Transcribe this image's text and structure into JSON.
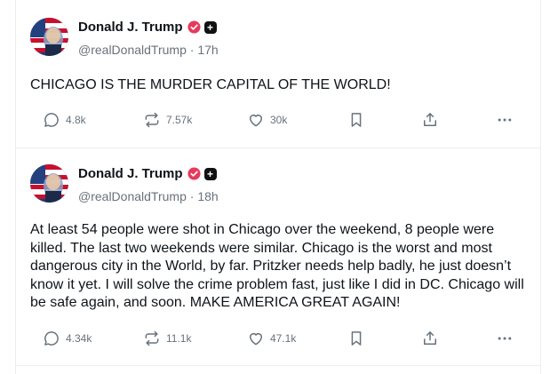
{
  "posts": [
    {
      "author": "Donald J. Trump",
      "handle": "@realDonaldTrump",
      "time": "17h",
      "text": "CHICAGO IS THE MURDER CAPITAL OF THE WORLD!",
      "replies": "4.8k",
      "reposts": "7.57k",
      "likes": "30k"
    },
    {
      "author": "Donald J. Trump",
      "handle": "@realDonaldTrump",
      "time": "18h",
      "text": "At least 54 people were shot in Chicago over the weekend, 8 people were killed. The last two weekends were similar. Chicago is the worst and most dangerous city in the World, by far. Pritzker needs help badly, he just doesn’t know it yet. I will solve the crime problem fast, just like I did in DC. Chicago will be safe again, and soon. MAKE AMERICA GREAT AGAIN!",
      "replies": "4.34k",
      "reposts": "11.1k",
      "likes": "47.1k"
    }
  ],
  "meta_separator": " · ",
  "badge_plus": "+",
  "colors": {
    "verified": "#e53a5e",
    "muted": "#68727b",
    "text": "#0f1419",
    "divider": "#eceef0"
  },
  "icons": [
    "avatar",
    "verified-icon",
    "plus-badge-icon",
    "reply-icon",
    "repost-icon",
    "like-icon",
    "bookmark-icon",
    "share-icon",
    "more-icon"
  ]
}
